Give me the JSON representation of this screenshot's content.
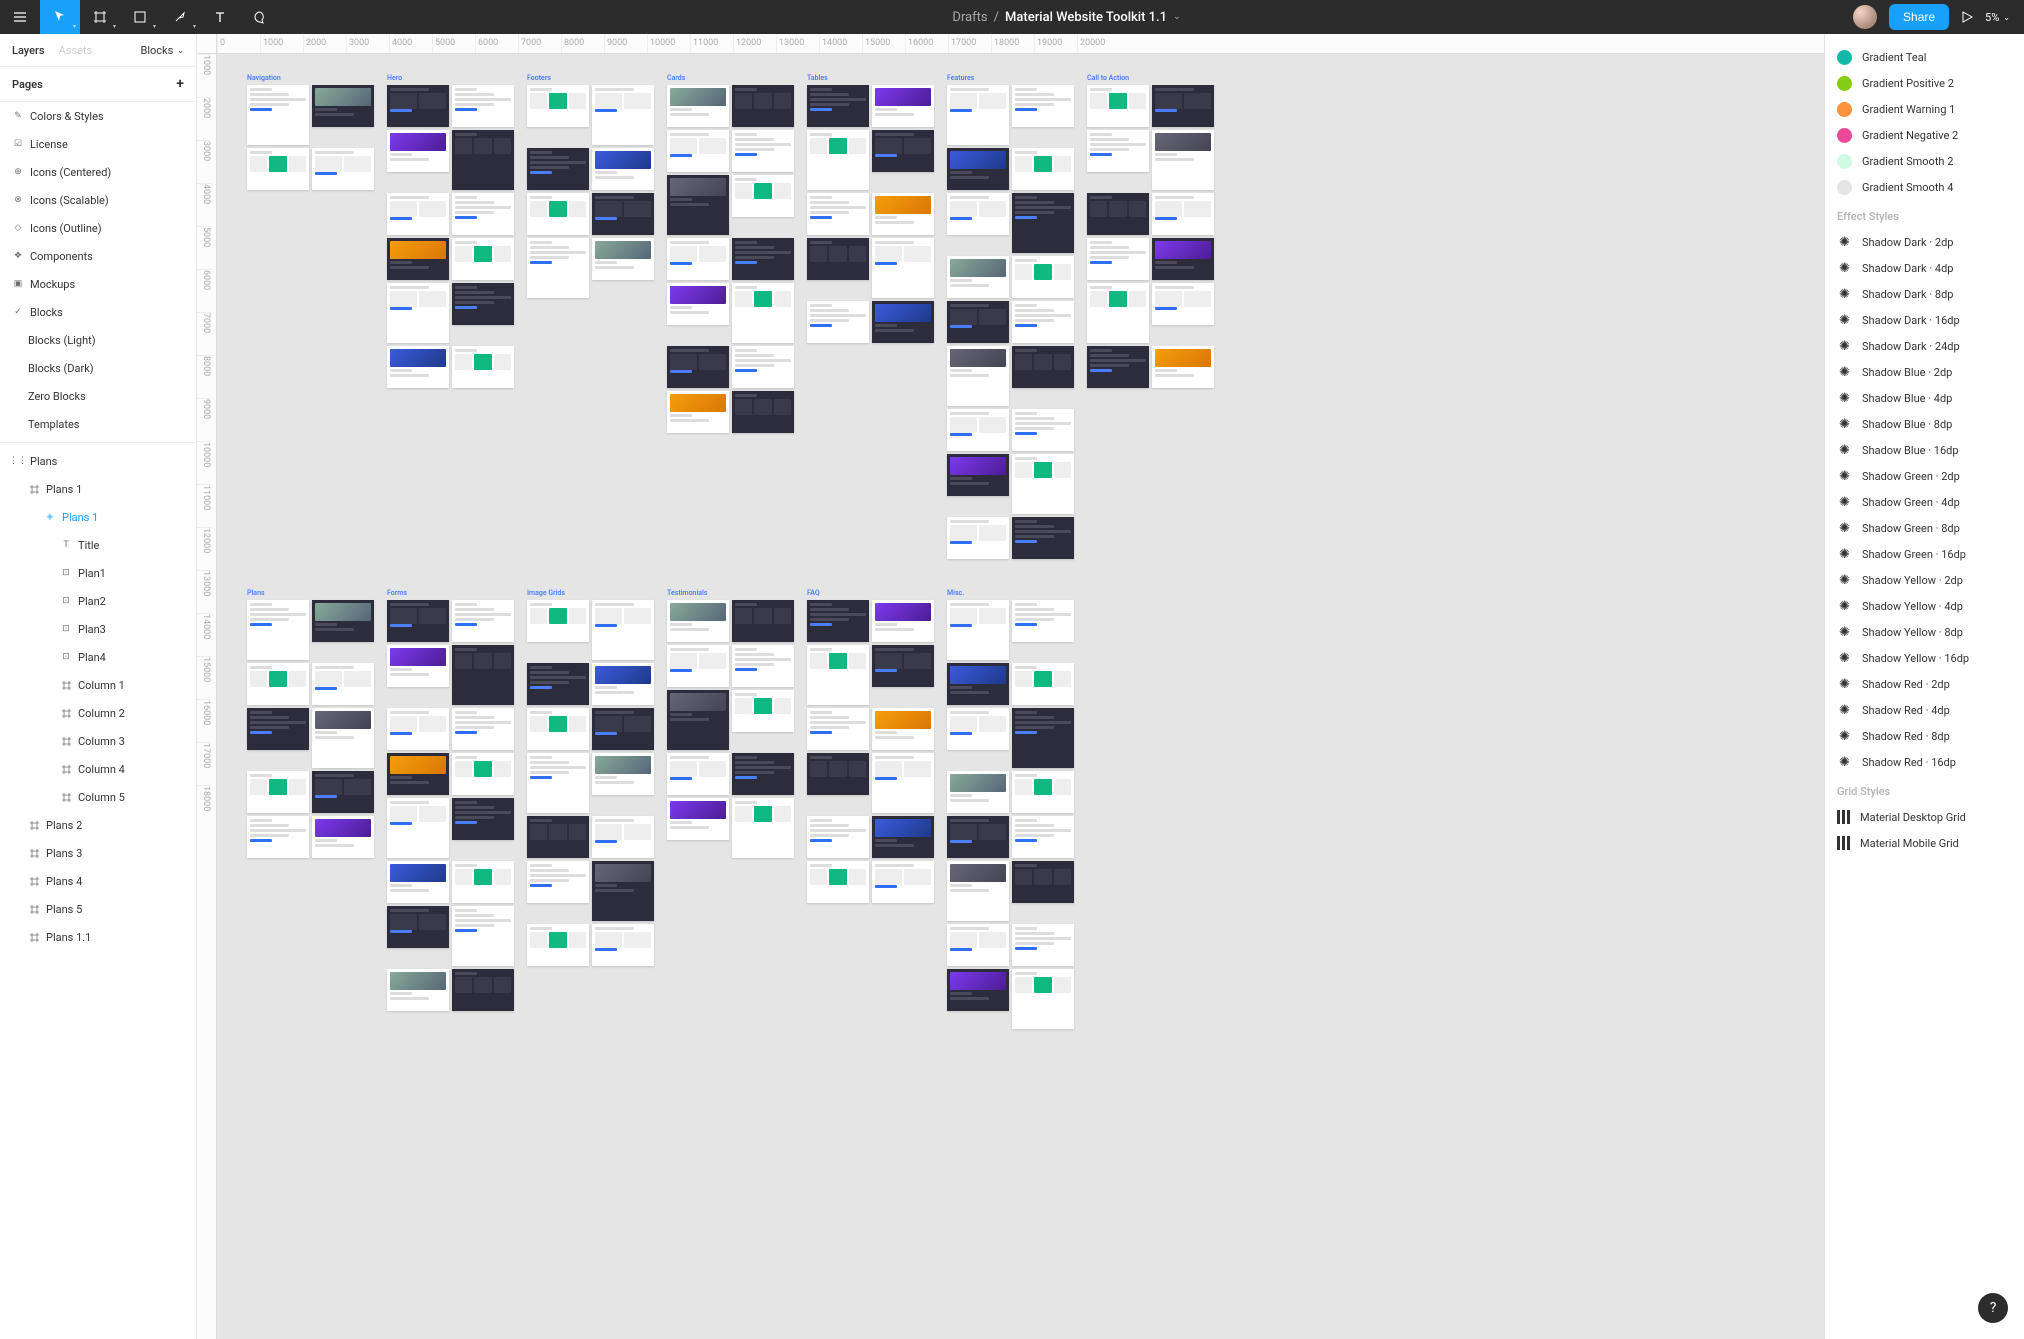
{
  "topbar": {
    "breadcrumb_parent": "Drafts",
    "breadcrumb_sep": "/",
    "doc_title": "Material Website Toolkit 1.1",
    "share_label": "Share",
    "zoom_label": "5%"
  },
  "left": {
    "tabs": {
      "layers": "Layers",
      "assets": "Assets",
      "blocks": "Blocks"
    },
    "pages_label": "Pages",
    "pages": [
      {
        "label": "Colors & Styles",
        "icon": "paint"
      },
      {
        "label": "License",
        "icon": "doc"
      },
      {
        "label": "Icons (Centered)",
        "icon": "circle-plus"
      },
      {
        "label": "Icons (Scalable)",
        "icon": "circle-x"
      },
      {
        "label": "Icons (Outline)",
        "icon": "diamond-sm"
      },
      {
        "label": "Components",
        "icon": "diamond4"
      },
      {
        "label": "Mockups",
        "icon": "device"
      },
      {
        "label": "Blocks",
        "icon": "check",
        "selected": true
      },
      {
        "label": "Blocks (Light)",
        "icon": ""
      },
      {
        "label": "Blocks (Dark)",
        "icon": ""
      },
      {
        "label": "Zero Blocks",
        "icon": ""
      },
      {
        "label": "Templates",
        "icon": ""
      }
    ],
    "layers": [
      {
        "label": "Plans",
        "icon": "dots",
        "indent": 0
      },
      {
        "label": "Plans 1",
        "icon": "frame",
        "indent": 1
      },
      {
        "label": "Plans 1",
        "icon": "diamond",
        "indent": 2,
        "selected": true
      },
      {
        "label": "Title",
        "icon": "text",
        "indent": 3
      },
      {
        "label": "Plan1",
        "icon": "comp",
        "indent": 3
      },
      {
        "label": "Plan2",
        "icon": "comp",
        "indent": 3
      },
      {
        "label": "Plan3",
        "icon": "comp",
        "indent": 3
      },
      {
        "label": "Plan4",
        "icon": "comp",
        "indent": 3
      },
      {
        "label": "Column 1",
        "icon": "frame",
        "indent": 3
      },
      {
        "label": "Column 2",
        "icon": "frame",
        "indent": 3
      },
      {
        "label": "Column 3",
        "icon": "frame",
        "indent": 3
      },
      {
        "label": "Column 4",
        "icon": "frame",
        "indent": 3
      },
      {
        "label": "Column 5",
        "icon": "frame",
        "indent": 3
      },
      {
        "label": "Plans 2",
        "icon": "frame",
        "indent": 1
      },
      {
        "label": "Plans 3",
        "icon": "frame",
        "indent": 1
      },
      {
        "label": "Plans 4",
        "icon": "frame",
        "indent": 1
      },
      {
        "label": "Plans 5",
        "icon": "frame",
        "indent": 1
      },
      {
        "label": "Plans 1.1",
        "icon": "frame",
        "indent": 1
      }
    ]
  },
  "ruler_h": [
    "0",
    "1000",
    "2000",
    "3000",
    "4000",
    "5000",
    "6000",
    "7000",
    "8000",
    "9000",
    "10000",
    "11000",
    "12000",
    "13000",
    "14000",
    "15000",
    "16000",
    "17000",
    "18000",
    "19000",
    "20000"
  ],
  "ruler_v": [
    "1000",
    "2000",
    "3000",
    "4000",
    "5000",
    "6000",
    "7000",
    "8000",
    "9000",
    "10000",
    "11000",
    "12000",
    "13000",
    "14000",
    "15000",
    "16000",
    "17000",
    "18000"
  ],
  "artboard_groups_row1": [
    "Navigation",
    "Hero",
    "Footers",
    "Cards",
    "Tables",
    "Features",
    "Call to Action"
  ],
  "artboard_groups_row2": [
    "Plans",
    "Forms",
    "Image Grids",
    "Testimonials",
    "FAQ",
    "Misc."
  ],
  "right": {
    "colors": [
      {
        "label": "Gradient Teal",
        "c": "#14b8a6"
      },
      {
        "label": "Gradient Positive 2",
        "c": "#84cc16"
      },
      {
        "label": "Gradient Warning 1",
        "c": "#fb923c"
      },
      {
        "label": "Gradient Negative 2",
        "c": "#ec4899"
      },
      {
        "label": "Gradient Smooth 2",
        "c": "#d1fae5"
      },
      {
        "label": "Gradient Smooth 4",
        "c": "#e5e5e5"
      }
    ],
    "effect_label": "Effect Styles",
    "effects": [
      "Shadow Dark · 2dp",
      "Shadow Dark · 4dp",
      "Shadow Dark · 8dp",
      "Shadow Dark · 16dp",
      "Shadow Dark · 24dp",
      "Shadow Blue · 2dp",
      "Shadow Blue · 4dp",
      "Shadow Blue · 8dp",
      "Shadow Blue · 16dp",
      "Shadow Green · 2dp",
      "Shadow Green · 4dp",
      "Shadow Green · 8dp",
      "Shadow Green · 16dp",
      "Shadow Yellow · 2dp",
      "Shadow Yellow · 4dp",
      "Shadow Yellow · 8dp",
      "Shadow Yellow · 16dp",
      "Shadow Red · 2dp",
      "Shadow Red · 4dp",
      "Shadow Red · 8dp",
      "Shadow Red · 16dp"
    ],
    "grid_label": "Grid Styles",
    "grids": [
      "Material Desktop Grid",
      "Material Mobile Grid"
    ]
  },
  "help": "?"
}
